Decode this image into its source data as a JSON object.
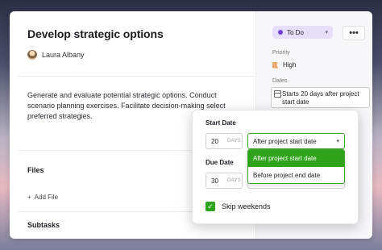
{
  "task": {
    "title": "Develop strategic options",
    "assignee": "Laura Albany",
    "description": "Generate and evaluate potential strategic options. Conduct scenario planning exercises. Facilitate decision-making select preferred strategies.",
    "files_label": "Files",
    "add_file_label": "Add File",
    "subtasks_label": "Subtasks"
  },
  "sidebar": {
    "status": "To Do",
    "more_label": "•••",
    "priority_label": "Priority",
    "priority_value": "High",
    "dates_label": "Dates",
    "dates_value": "Starts 20 days after project start date"
  },
  "popup": {
    "start_label": "Start Date",
    "start_value": "20",
    "start_unit": "DAYS",
    "start_anchor": "After project start date",
    "due_label": "Due Date",
    "due_value": "30",
    "due_unit": "DAYS",
    "options": [
      "After project start date",
      "Before project end date"
    ],
    "skip_weekends": "Skip weekends"
  },
  "colors": {
    "accent_green": "#2fa31b",
    "status_purple": "#6b3fd4",
    "priority_orange": "#f0a86e"
  }
}
